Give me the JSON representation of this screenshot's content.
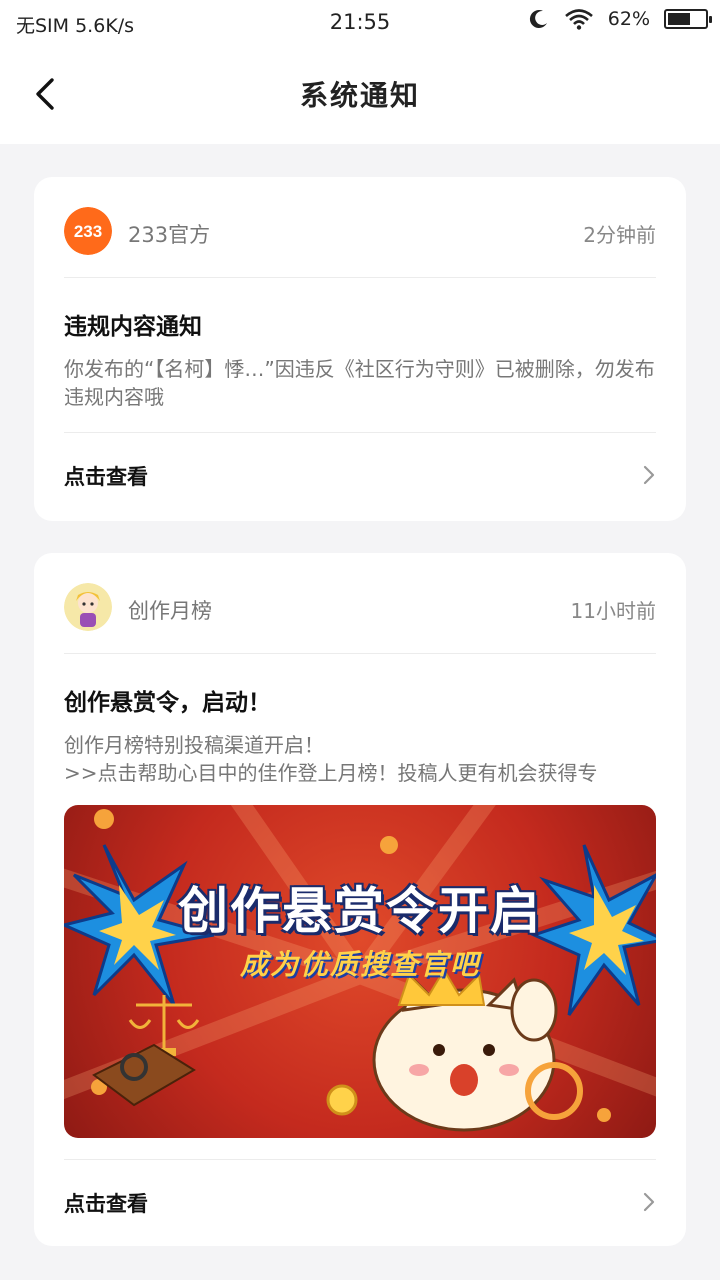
{
  "status_bar": {
    "carrier": "无SIM 5.6K/s",
    "time": "21:55",
    "battery": "62%",
    "battery_level": 0.62
  },
  "header": {
    "title": "系统通知"
  },
  "notifications": [
    {
      "source": "233官方",
      "time": "2分钟前",
      "title": "违规内容通知",
      "body": "你发布的“【名柯】悸…”因违反《社区行为守则》已被删除，勿发布违规内容哦",
      "action": "点击查看",
      "avatar_text": "233",
      "avatar_color": "#ff6a1a"
    },
    {
      "source": "创作月榜",
      "time": "11小时前",
      "title": "创作悬赏令，启动！",
      "body": "创作月榜特别投稿渠道开启！\n>>点击帮助心目中的佳作登上月榜！投稿人更有机会获得专",
      "action": "点击查看",
      "banner": {
        "title": "创作悬赏令开启",
        "subtitle": "成为优质搜查官吧"
      }
    }
  ],
  "colors": {
    "accent_orange": "#ff6a1a",
    "banner_red": "#c42a1e",
    "banner_yellow": "#ffd24a"
  }
}
